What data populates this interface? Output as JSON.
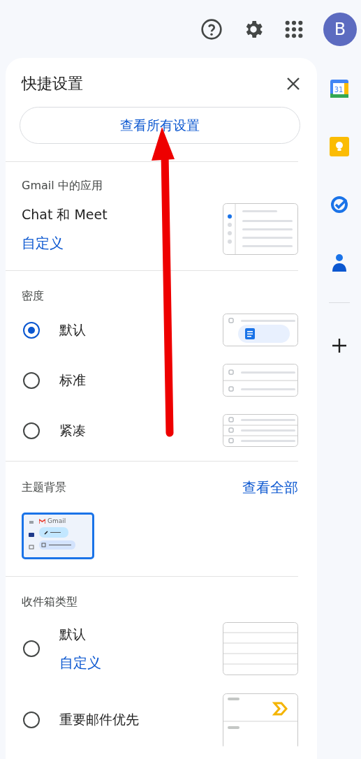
{
  "topbar": {
    "avatar_letter": "B"
  },
  "panel": {
    "title": "快捷设置",
    "all_settings_button": "查看所有设置",
    "apps_section": {
      "heading": "Gmail 中的应用",
      "item": "Chat 和 Meet",
      "link": "自定义"
    },
    "density": {
      "heading": "密度",
      "options": [
        {
          "label": "默认",
          "selected": true,
          "kind": "default"
        },
        {
          "label": "标准",
          "selected": false,
          "kind": "comfortable"
        },
        {
          "label": "紧凑",
          "selected": false,
          "kind": "compact"
        }
      ]
    },
    "theme": {
      "heading": "主题背景",
      "link": "查看全部",
      "thumbnail_label": "Gmail"
    },
    "inbox_type": {
      "heading": "收件箱类型",
      "options": [
        {
          "label": "默认",
          "link": "自定义",
          "selected": false,
          "kind": "default"
        },
        {
          "label": "重要邮件优先",
          "selected": false,
          "kind": "important"
        }
      ]
    }
  },
  "sidebar": {
    "calendar_day": "31"
  }
}
